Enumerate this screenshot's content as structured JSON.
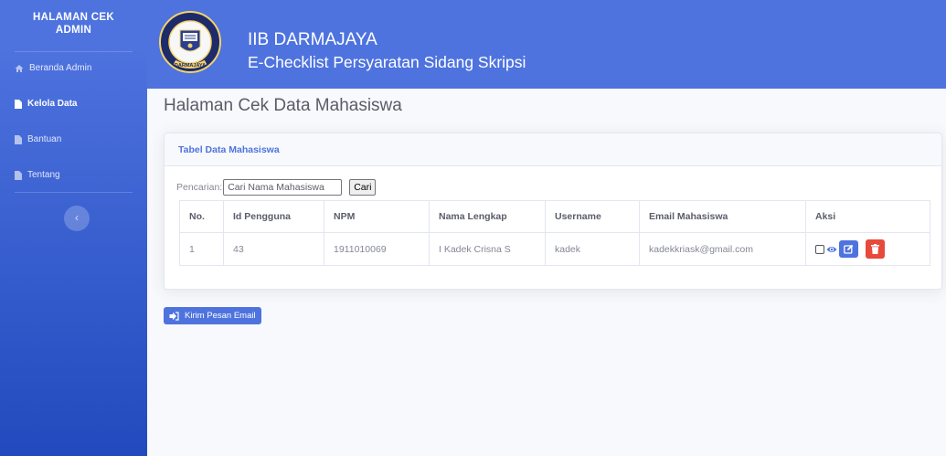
{
  "sidebar": {
    "brand_line1": "HALAMAN CEK",
    "brand_line2": "ADMIN",
    "items": [
      {
        "label": "Beranda Admin",
        "icon": "home-icon"
      },
      {
        "label": "Kelola Data",
        "icon": "file-icon"
      },
      {
        "label": "Bantuan",
        "icon": "file-icon"
      },
      {
        "label": "Tentang",
        "icon": "file-icon"
      }
    ],
    "toggle_glyph": "‹"
  },
  "header": {
    "org": "IIB DARMAJAYA",
    "system": "E-Checklist Persyaratan Sidang Skripsi",
    "logo_text": "DARMAJAYA"
  },
  "main": {
    "page_title": "Halaman Cek Data Mahasiswa",
    "card_title": "Tabel Data Mahasiswa",
    "search_label": "Pencarian:",
    "search_value": "Cari Nama Mahasiswa",
    "search_button": "Cari",
    "columns": [
      "No.",
      "Id Pengguna",
      "NPM",
      "Nama Lengkap",
      "Username",
      "Email Mahasiswa",
      "Aksi"
    ],
    "rows": [
      {
        "no": "1",
        "id": "43",
        "npm": "1911010069",
        "nama": "I Kadek Crisna S",
        "username": "kadek",
        "email": "kadekkriask@gmail.com"
      }
    ],
    "email_button": "Kirim Pesan Email"
  },
  "colors": {
    "primary": "#4e73df",
    "danger": "#e74a3b",
    "sidebar_dark": "#224abe"
  }
}
